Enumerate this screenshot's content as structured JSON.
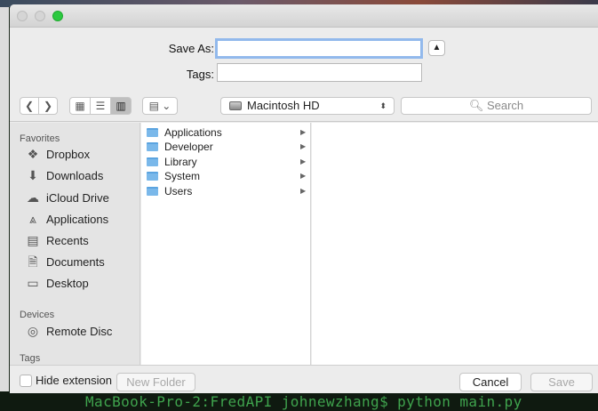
{
  "dialog": {
    "save_as_label": "Save As:",
    "save_as_value": "",
    "tags_label": "Tags:",
    "tags_value": "",
    "expand_icon": "chevron-up-icon"
  },
  "toolbar": {
    "location": "Macintosh HD",
    "search_placeholder": "Search"
  },
  "sidebar": {
    "favorites_header": "Favorites",
    "favorites": [
      {
        "label": "Dropbox",
        "icon": "dropbox-icon"
      },
      {
        "label": "Downloads",
        "icon": "downloads-icon"
      },
      {
        "label": "iCloud Drive",
        "icon": "cloud-icon"
      },
      {
        "label": "Applications",
        "icon": "applications-icon"
      },
      {
        "label": "Recents",
        "icon": "recents-icon"
      },
      {
        "label": "Documents",
        "icon": "documents-icon"
      },
      {
        "label": "Desktop",
        "icon": "desktop-icon"
      }
    ],
    "devices_header": "Devices",
    "devices": [
      {
        "label": "Remote Disc",
        "icon": "disc-icon"
      }
    ],
    "tags_header": "Tags"
  },
  "browser": {
    "column1": [
      "Applications",
      "Developer",
      "Library",
      "System",
      "Users"
    ]
  },
  "bottom": {
    "hide_extension": "Hide extension",
    "new_folder": "New Folder",
    "cancel": "Cancel",
    "save": "Save"
  },
  "terminal": {
    "text": "MacBook-Pro-2:FredAPI johnewzhang$ python main.py"
  },
  "colors": {
    "focus_ring": "#92b9ec",
    "folder_blue": "#7ab8ea",
    "terminal_green": "#3fa34d",
    "zoom_green": "#2cc940"
  }
}
